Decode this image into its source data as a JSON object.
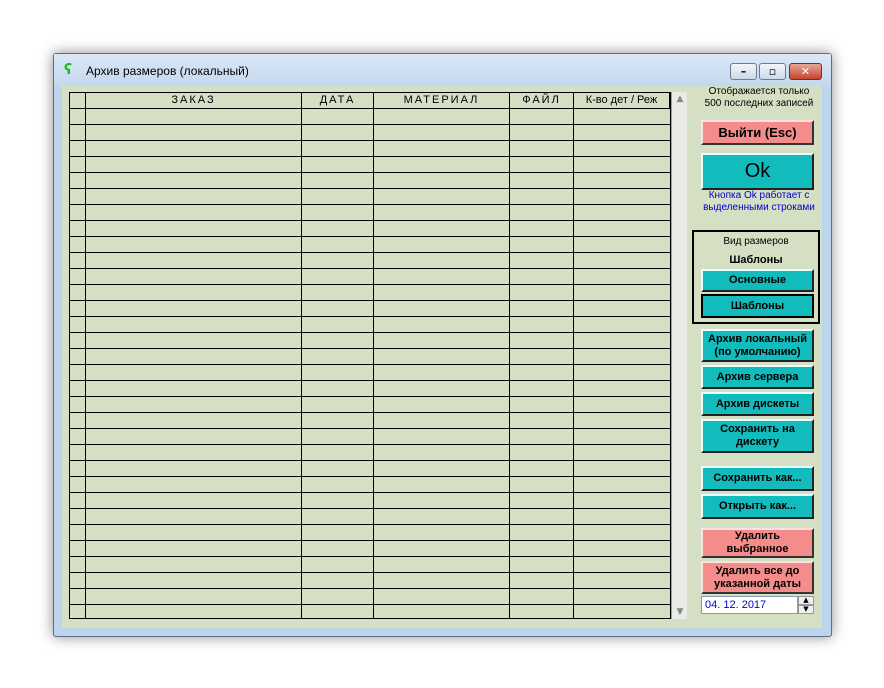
{
  "window": {
    "title": "Архив размеров (локальный)",
    "controls": {
      "minimize": "–",
      "maximize": "▫",
      "close": "✕"
    }
  },
  "grid": {
    "columns": [
      "ЗАКАЗ",
      "ДАТА",
      "МАТЕРИАЛ",
      "ФАЙЛ",
      "К-во дет / Реж"
    ]
  },
  "info": {
    "records_line1": "Отображается только",
    "records_line2": "500 последних записей",
    "ok_hint_line1": "Кнопка Ok работает с",
    "ok_hint_line2": "выделенными строками"
  },
  "buttons": {
    "exit": "Выйти   (Esc)",
    "ok": "Ok",
    "view_main": "Основные",
    "view_templates": "Шаблоны",
    "archive_local_1": "Архив локальный",
    "archive_local_2": "(по умолчанию)",
    "archive_server": "Архив сервера",
    "archive_disk": "Архив дискеты",
    "save_disk_1": "Сохранить на",
    "save_disk_2": "дискету",
    "save_as": "Сохранить как...",
    "open_as": "Открыть как...",
    "delete_selected_1": "Удалить",
    "delete_selected_2": "выбранное",
    "delete_before_1": "Удалить все до",
    "delete_before_2": "указанной даты"
  },
  "view_group": {
    "title": "Вид размеров",
    "current": "Шаблоны"
  },
  "date_field": {
    "value": "04. 12. 2017"
  },
  "colors": {
    "grid_bg": "#d4dfc4",
    "teal_button": "#12bcbc",
    "red_button": "#f58c8c",
    "hint_text": "#0000cc"
  }
}
